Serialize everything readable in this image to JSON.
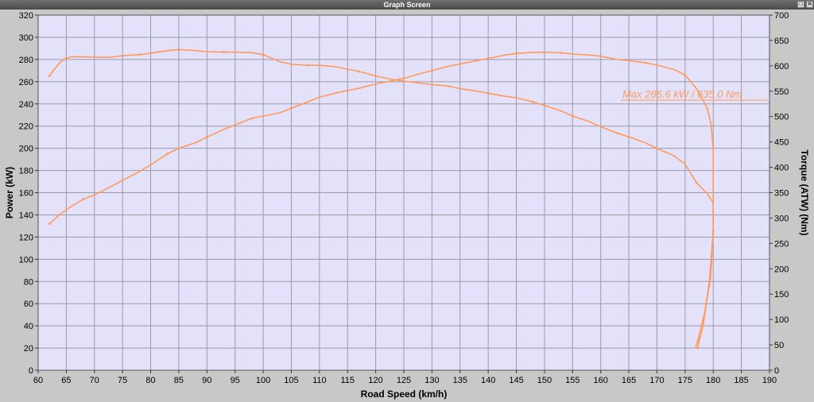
{
  "window": {
    "title": "Graph Screen",
    "restore_icon": "restore-icon",
    "close_icon": "close-icon"
  },
  "colors": {
    "curve": "#ff9a5a",
    "plot_bg": "#e4e2fb",
    "grid": "#9a9aa4",
    "axis_text": "#000000",
    "annotation": "#ff9a5a"
  },
  "chart_data": {
    "type": "line",
    "title": "",
    "xlabel": "Road Speed (km/h)",
    "ylabel_left": "Power (kW)",
    "ylabel_right": "Torque (ATW) (Nm)",
    "xlim": [
      60,
      190
    ],
    "ylim_left": [
      0,
      320
    ],
    "ylim_right": [
      0,
      700
    ],
    "x_ticks": [
      60,
      65,
      70,
      75,
      80,
      85,
      90,
      95,
      100,
      105,
      110,
      115,
      120,
      125,
      130,
      135,
      140,
      145,
      150,
      155,
      160,
      165,
      170,
      175,
      180,
      185,
      190
    ],
    "y_left_ticks": [
      0,
      20,
      40,
      60,
      80,
      100,
      120,
      140,
      160,
      180,
      200,
      220,
      240,
      260,
      280,
      300,
      320
    ],
    "y_right_ticks": [
      0,
      50,
      100,
      150,
      200,
      250,
      300,
      350,
      400,
      450,
      500,
      550,
      600,
      650,
      700
    ],
    "grid": true,
    "annotation": "Max 286.6 kW  / 635.0 Nm",
    "series": [
      {
        "axis": "left",
        "x": [
          62,
          64,
          66,
          68,
          70,
          72,
          75,
          78,
          80,
          83,
          85,
          88,
          90,
          93,
          95,
          98,
          100,
          103,
          105,
          108,
          110,
          113,
          117,
          120,
          123,
          125,
          127,
          130,
          133,
          135,
          138,
          140,
          143,
          145,
          148,
          150,
          153,
          155,
          158,
          160,
          163,
          165,
          168,
          170,
          173,
          175,
          177,
          178,
          179,
          179.6,
          180,
          180,
          179.3,
          178.2,
          177.2
        ],
        "y": [
          132,
          141,
          148,
          154,
          158,
          163,
          171,
          179,
          185,
          195,
          200,
          205,
          210,
          217,
          221,
          227,
          229,
          232,
          236,
          242,
          246,
          250,
          254,
          258,
          261,
          263,
          266,
          270,
          274,
          276,
          279,
          281,
          284,
          285.5,
          286.4,
          286.6,
          286,
          285,
          284,
          283,
          280,
          279,
          277,
          275,
          271,
          266,
          254,
          245,
          235,
          222,
          200,
          125,
          80,
          40,
          20
        ]
      },
      {
        "axis": "right",
        "x": [
          62,
          63,
          64,
          65,
          66,
          68,
          70,
          73,
          75,
          78,
          80,
          83,
          85,
          88,
          90,
          93,
          95,
          98,
          100,
          103,
          105,
          108,
          110,
          113,
          117,
          120,
          123,
          125,
          127,
          130,
          133,
          135,
          138,
          140,
          143,
          145,
          148,
          150,
          153,
          155,
          158,
          160,
          163,
          165,
          168,
          170,
          173,
          175,
          177,
          179,
          180,
          180,
          179.5,
          178.5,
          177.3,
          176.8
        ],
        "y": [
          580,
          595,
          608,
          615,
          618,
          618,
          617,
          617,
          620,
          622,
          625,
          630,
          632,
          630,
          628,
          627,
          627,
          626,
          622,
          608,
          603,
          601,
          601,
          598,
          589,
          580,
          573,
          570,
          567,
          563,
          560,
          555,
          550,
          546,
          540,
          537,
          529,
          522,
          511,
          501,
          490,
          480,
          467,
          460,
          448,
          437,
          423,
          406,
          370,
          347,
          330,
          268,
          180,
          115,
          60,
          43
        ]
      }
    ]
  }
}
